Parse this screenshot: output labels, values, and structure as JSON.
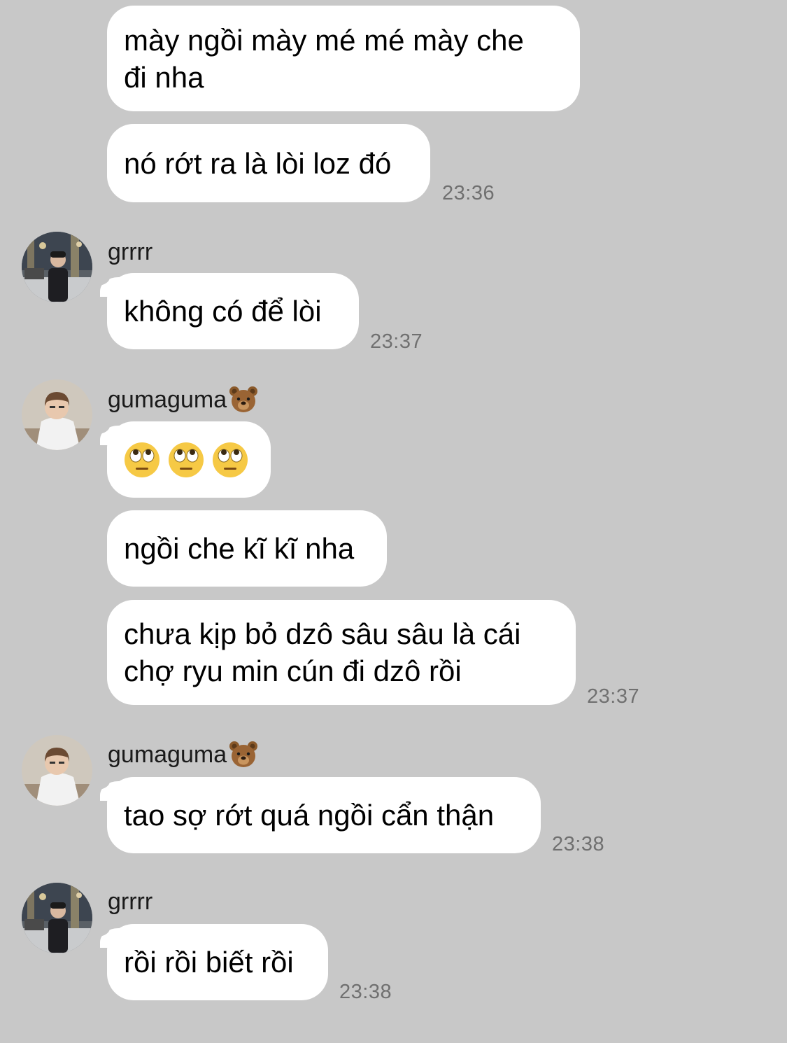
{
  "messages": [
    {
      "lines": [
        "mày ngồi mày mé mé mày che",
        "đi nha"
      ]
    },
    {
      "lines": [
        "nó rớt ra là lòi loz đó"
      ],
      "time": "23:36"
    },
    {
      "sender": "grrrr",
      "lines": [
        "không có để lòi"
      ],
      "time": "23:37"
    },
    {
      "sender": "gumaguma",
      "sender_emoji": "bear-face-icon",
      "emoji": [
        "face-with-rolling-eyes-icon",
        "face-with-rolling-eyes-icon",
        "face-with-rolling-eyes-icon"
      ]
    },
    {
      "lines": [
        "ngồi che kĩ kĩ nha"
      ]
    },
    {
      "lines": [
        "chưa kịp bỏ dzô sâu sâu là cái",
        "chợ ryu min cún đi dzô rồi"
      ],
      "time": "23:37"
    },
    {
      "sender": "gumaguma",
      "sender_emoji": "bear-face-icon",
      "lines": [
        "tao sợ rớt quá ngồi cẩn thận"
      ],
      "time": "23:38"
    },
    {
      "sender": "grrrr",
      "lines": [
        "rồi rồi biết rồi"
      ],
      "time": "23:38"
    }
  ],
  "colors": {
    "background": "#c8c8c8",
    "bubble": "#ffffff",
    "timestamp": "#707070"
  }
}
